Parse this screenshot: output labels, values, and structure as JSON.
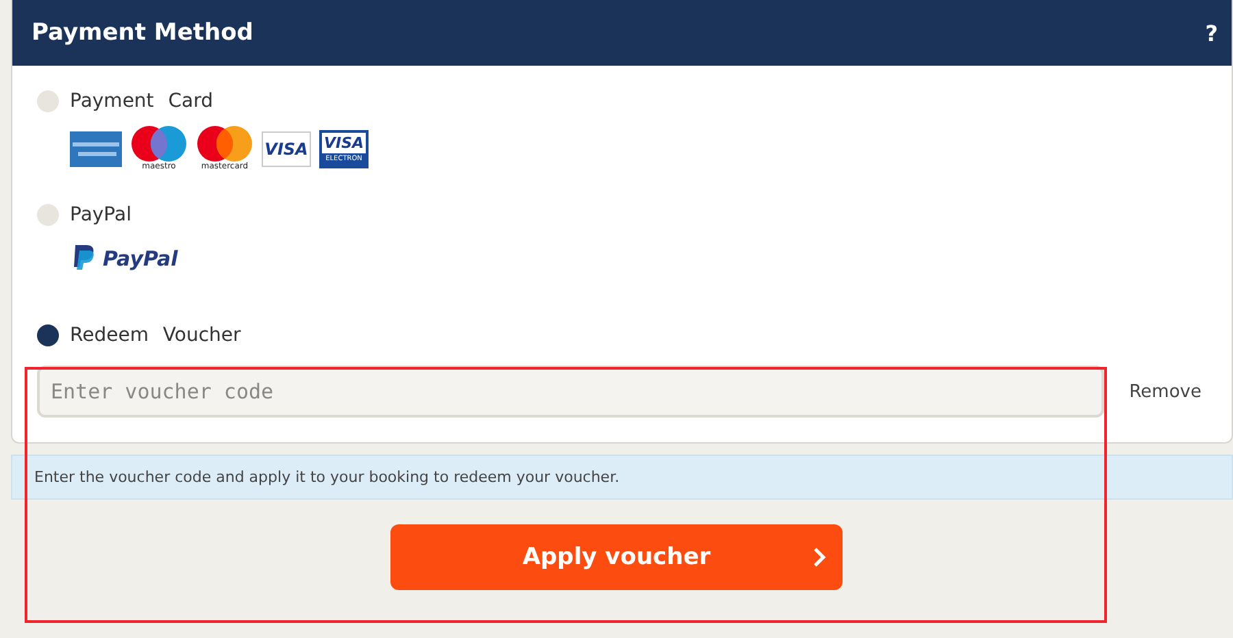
{
  "header": {
    "title": "Payment Method",
    "help": "?"
  },
  "options": [
    {
      "kind": "cards",
      "label": "Payment Card",
      "selected": false,
      "logos": [
        {
          "kind": "amex"
        },
        {
          "kind": "maestro",
          "caption": "maestro"
        },
        {
          "kind": "mastercard",
          "caption": "mastercard"
        },
        {
          "kind": "visa",
          "text": "VISA"
        },
        {
          "kind": "electron",
          "text": "VISA",
          "caption": "ELECTRON"
        }
      ]
    },
    {
      "kind": "paypal",
      "label": "PayPal",
      "selected": false,
      "logos": [
        {
          "kind": "paypal",
          "text": "PayPal"
        }
      ]
    },
    {
      "kind": "voucher",
      "label": "Redeem Voucher",
      "selected": true,
      "placeholder": "Enter voucher code",
      "remove": "Remove"
    }
  ],
  "info": "Enter the voucher code and apply it to your booking to redeem your voucher.",
  "button": {
    "label": "Apply voucher"
  },
  "highlight": {
    "on": true
  }
}
